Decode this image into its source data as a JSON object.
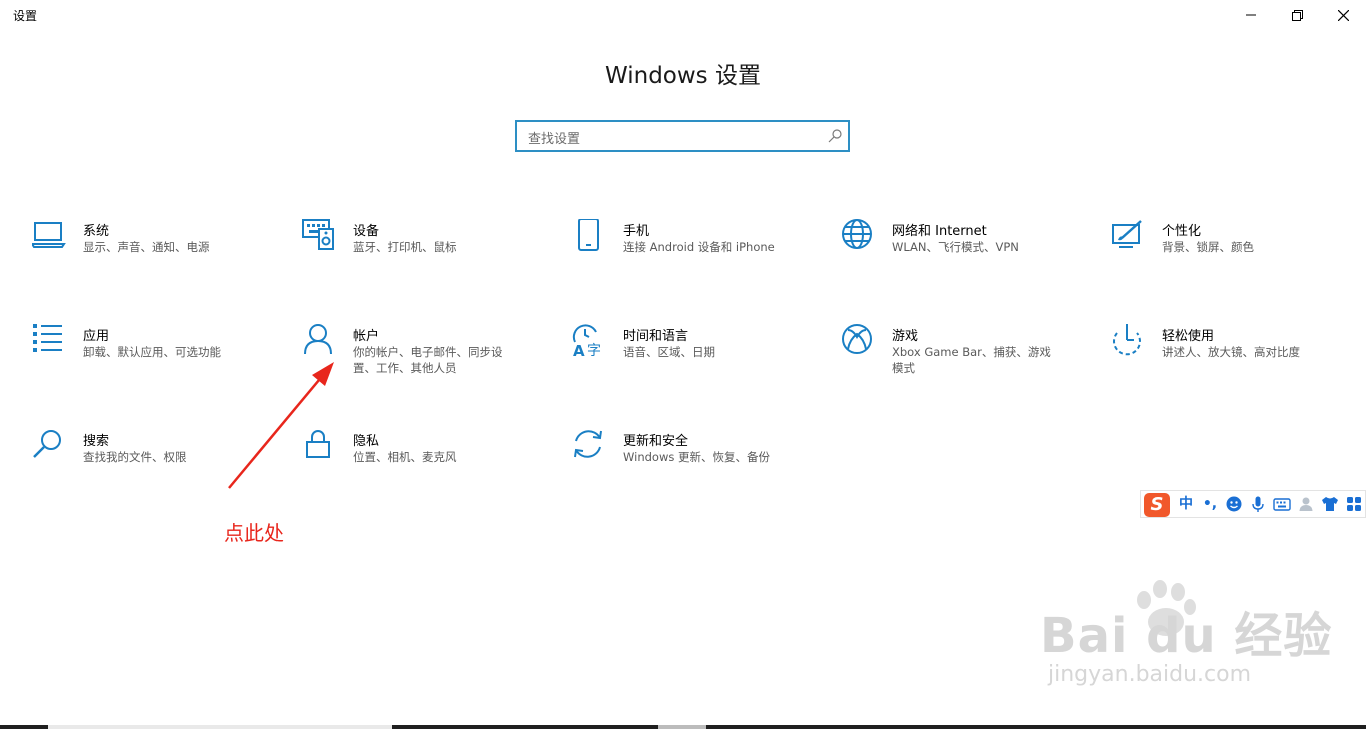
{
  "window": {
    "title": "设置"
  },
  "header": {
    "title": "Windows 设置"
  },
  "search": {
    "placeholder": "查找设置"
  },
  "tiles": [
    {
      "label": "系统",
      "desc": "显示、声音、通知、电源",
      "icon": "laptop-icon"
    },
    {
      "label": "设备",
      "desc": "蓝牙、打印机、鼠标",
      "icon": "keyboard-speaker-icon"
    },
    {
      "label": "手机",
      "desc": "连接 Android 设备和 iPhone",
      "icon": "phone-icon"
    },
    {
      "label": "网络和 Internet",
      "desc": "WLAN、飞行模式、VPN",
      "icon": "globe-icon"
    },
    {
      "label": "个性化",
      "desc": "背景、锁屏、颜色",
      "icon": "paint-screen-icon"
    },
    {
      "label": "应用",
      "desc": "卸载、默认应用、可选功能",
      "icon": "app-list-icon"
    },
    {
      "label": "帐户",
      "desc": "你的帐户、电子邮件、同步设置、工作、其他人员",
      "icon": "person-icon"
    },
    {
      "label": "时间和语言",
      "desc": "语音、区域、日期",
      "icon": "time-language-icon"
    },
    {
      "label": "游戏",
      "desc": "Xbox Game Bar、捕获、游戏模式",
      "icon": "xbox-icon"
    },
    {
      "label": "轻松使用",
      "desc": "讲述人、放大镜、高对比度",
      "icon": "ease-of-access-icon"
    },
    {
      "label": "搜索",
      "desc": "查找我的文件、权限",
      "icon": "magnifier-icon"
    },
    {
      "label": "隐私",
      "desc": "位置、相机、麦克风",
      "icon": "lock-icon"
    },
    {
      "label": "更新和安全",
      "desc": "Windows 更新、恢复、备份",
      "icon": "sync-icon"
    }
  ],
  "annotation": {
    "text": "点此处"
  },
  "ime": {
    "logo": "S",
    "lang": "中",
    "punct": "•,",
    "items": [
      "emoji-icon",
      "mic-icon",
      "keyboard-icon",
      "user-icon",
      "shirt-icon",
      "grid-icon"
    ]
  },
  "watermark": {
    "main": "Bai du 经验",
    "sub": "jingyan.baidu.com"
  },
  "colors": {
    "accent": "#2d8fc4",
    "annotation": "#e8261c",
    "ime_logo": "#f1582b"
  }
}
